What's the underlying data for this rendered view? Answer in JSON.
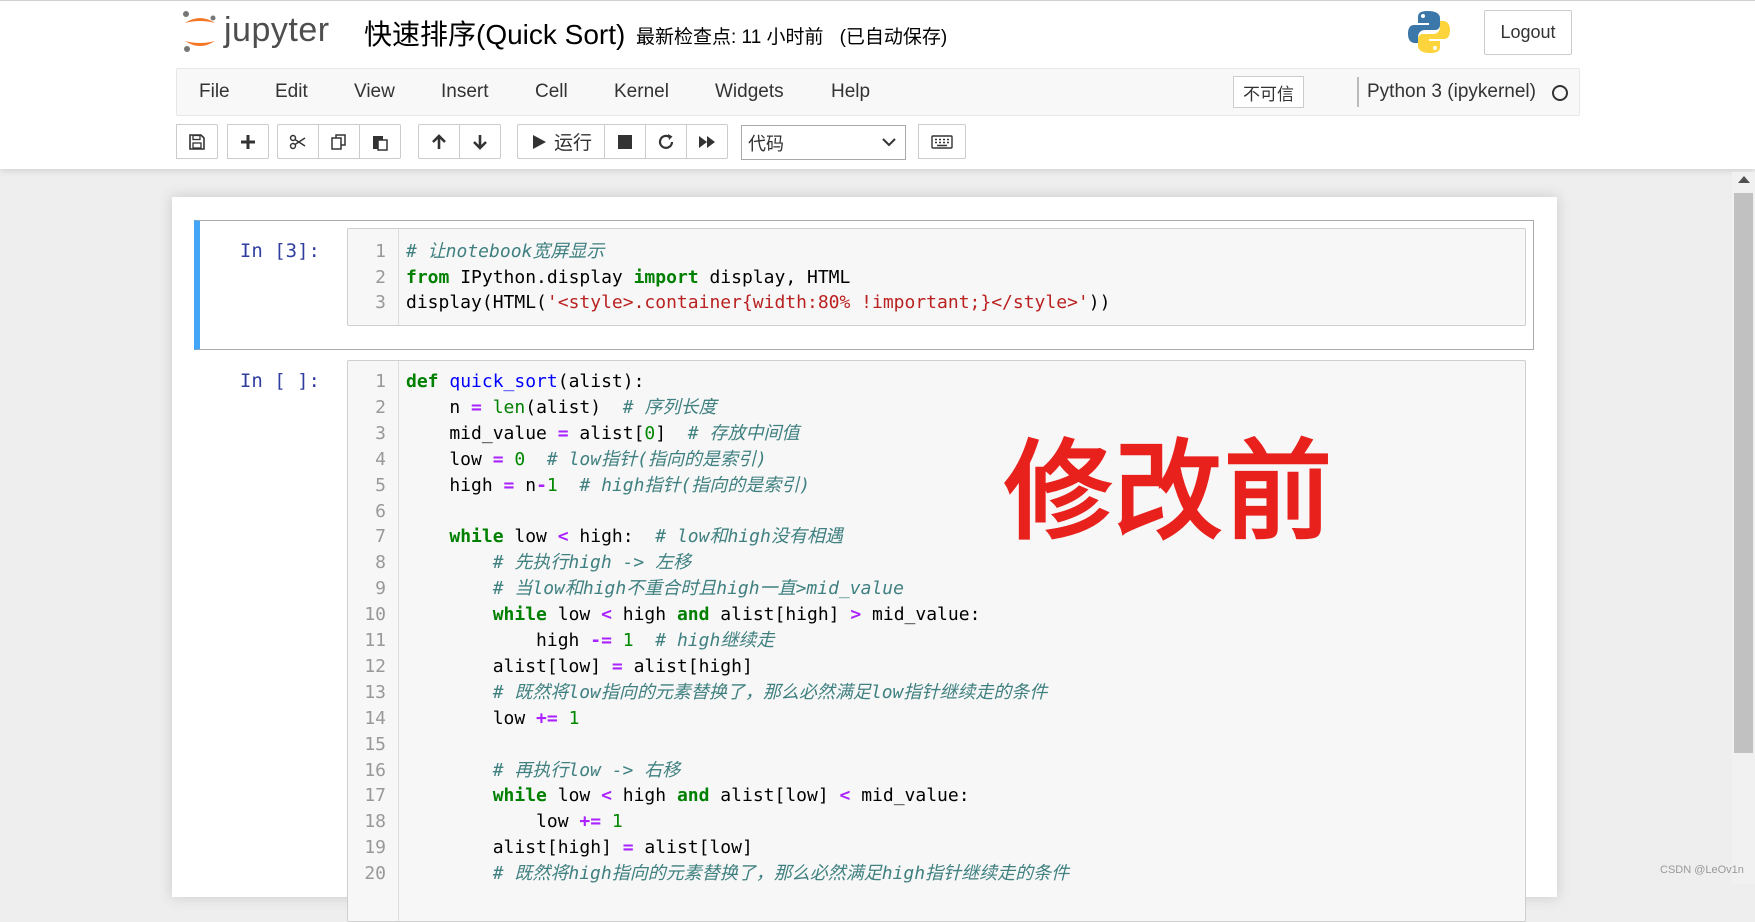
{
  "header": {
    "logo_text": "jupyter",
    "notebook_title": "快速排序(Quick Sort)",
    "checkpoint": "最新检查点: 11 小时前",
    "autosave": "(已自动保存)",
    "logout_label": "Logout"
  },
  "menubar": {
    "items": [
      "File",
      "Edit",
      "View",
      "Insert",
      "Cell",
      "Kernel",
      "Widgets",
      "Help"
    ],
    "trust_label": "不可信",
    "kernel_name": "Python 3 (ipykernel)"
  },
  "toolbar": {
    "run_label": "运行",
    "cell_type": "代码"
  },
  "cells": [
    {
      "prompt": "In  [3]:",
      "lines": [
        [
          [
            "cm-comment",
            "# 让notebook宽屏显示"
          ]
        ],
        [
          [
            "cm-keyword",
            "from"
          ],
          [
            "",
            " IPython.display "
          ],
          [
            "cm-keyword",
            "import"
          ],
          [
            "",
            " display, HTML"
          ]
        ],
        [
          [
            "",
            "display(HTML("
          ],
          [
            "cm-string",
            "'<style>.container{width:80% !important;}</style>'"
          ],
          [
            "",
            "))"
          ]
        ]
      ]
    },
    {
      "prompt": "In  [ ]:",
      "lines": [
        [
          [
            "cm-keyword",
            "def"
          ],
          [
            "",
            " "
          ],
          [
            "cm-def",
            "quick_sort"
          ],
          [
            "",
            "(alist):"
          ]
        ],
        [
          [
            "",
            "    n "
          ],
          [
            "cm-operator",
            "="
          ],
          [
            "",
            " "
          ],
          [
            "cm-builtin",
            "len"
          ],
          [
            "",
            "(alist)  "
          ],
          [
            "cm-comment",
            "# 序列长度"
          ]
        ],
        [
          [
            "",
            "    mid_value "
          ],
          [
            "cm-operator",
            "="
          ],
          [
            "",
            " alist["
          ],
          [
            "cm-number",
            "0"
          ],
          [
            "",
            "]  "
          ],
          [
            "cm-comment",
            "# 存放中间值"
          ]
        ],
        [
          [
            "",
            "    low "
          ],
          [
            "cm-operator",
            "="
          ],
          [
            "",
            " "
          ],
          [
            "cm-number",
            "0"
          ],
          [
            "",
            "  "
          ],
          [
            "cm-comment",
            "# low指针(指向的是索引)"
          ]
        ],
        [
          [
            "",
            "    high "
          ],
          [
            "cm-operator",
            "="
          ],
          [
            "",
            " n"
          ],
          [
            "cm-operator",
            "-"
          ],
          [
            "cm-number",
            "1"
          ],
          [
            "",
            "  "
          ],
          [
            "cm-comment",
            "# high指针(指向的是索引)"
          ]
        ],
        [
          [
            "",
            ""
          ]
        ],
        [
          [
            "",
            "    "
          ],
          [
            "cm-keyword",
            "while"
          ],
          [
            "",
            " low "
          ],
          [
            "cm-operator",
            "<"
          ],
          [
            "",
            " high:  "
          ],
          [
            "cm-comment",
            "# low和high没有相遇"
          ]
        ],
        [
          [
            "",
            "        "
          ],
          [
            "cm-comment",
            "# 先执行high -> 左移"
          ]
        ],
        [
          [
            "",
            "        "
          ],
          [
            "cm-comment",
            "# 当low和high不重合时且high一直>mid_value"
          ]
        ],
        [
          [
            "",
            "        "
          ],
          [
            "cm-keyword",
            "while"
          ],
          [
            "",
            " low "
          ],
          [
            "cm-operator",
            "<"
          ],
          [
            "",
            " high "
          ],
          [
            "cm-keyword",
            "and"
          ],
          [
            "",
            " alist[high] "
          ],
          [
            "cm-operator",
            ">"
          ],
          [
            "",
            " mid_value:"
          ]
        ],
        [
          [
            "",
            "            high "
          ],
          [
            "cm-operator",
            "-="
          ],
          [
            "",
            " "
          ],
          [
            "cm-number",
            "1"
          ],
          [
            "",
            "  "
          ],
          [
            "cm-comment",
            "# high继续走"
          ]
        ],
        [
          [
            "",
            "        alist[low] "
          ],
          [
            "cm-operator",
            "="
          ],
          [
            "",
            " alist[high]"
          ]
        ],
        [
          [
            "",
            "        "
          ],
          [
            "cm-comment",
            "# 既然将low指向的元素替换了，那么必然满足low指针继续走的条件"
          ]
        ],
        [
          [
            "",
            "        low "
          ],
          [
            "cm-operator",
            "+="
          ],
          [
            "",
            " "
          ],
          [
            "cm-number",
            "1"
          ]
        ],
        [
          [
            "",
            ""
          ]
        ],
        [
          [
            "",
            "        "
          ],
          [
            "cm-comment",
            "# 再执行low -> 右移"
          ]
        ],
        [
          [
            "",
            "        "
          ],
          [
            "cm-keyword",
            "while"
          ],
          [
            "",
            " low "
          ],
          [
            "cm-operator",
            "<"
          ],
          [
            "",
            " high "
          ],
          [
            "cm-keyword",
            "and"
          ],
          [
            "",
            " alist[low] "
          ],
          [
            "cm-operator",
            "<"
          ],
          [
            "",
            " mid_value:"
          ]
        ],
        [
          [
            "",
            "            low "
          ],
          [
            "cm-operator",
            "+="
          ],
          [
            "",
            " "
          ],
          [
            "cm-number",
            "1"
          ]
        ],
        [
          [
            "",
            "        alist[high] "
          ],
          [
            "cm-operator",
            "="
          ],
          [
            "",
            " alist[low]"
          ]
        ],
        [
          [
            "",
            "        "
          ],
          [
            "cm-comment",
            "# 既然将high指向的元素替换了，那么必然满足high指针继续走的条件"
          ]
        ]
      ]
    }
  ],
  "annotation": "修改前",
  "watermark": "CSDN @LeOv1n",
  "colors": {
    "selected_cell_border": "#42a5f5",
    "annotation_red": "#e8211d",
    "prompt_blue": "#303f9f"
  }
}
